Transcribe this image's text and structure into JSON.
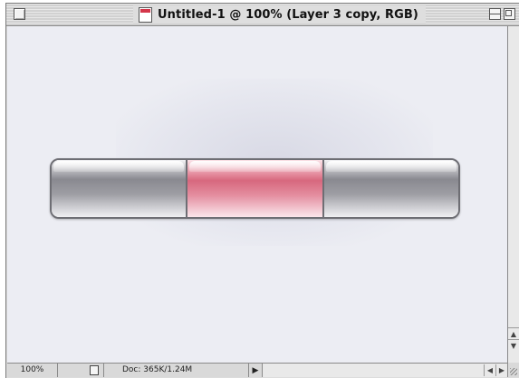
{
  "window": {
    "title": "Untitled-1 @ 100% (Layer 3 copy, RGB)"
  },
  "canvas": {
    "buttons": [
      {
        "name": "left-segment",
        "label": "",
        "state": "normal",
        "color": "#9e9ea4"
      },
      {
        "name": "middle-segment",
        "label": "",
        "state": "active",
        "color": "#d7687e"
      },
      {
        "name": "right-segment",
        "label": "",
        "state": "normal",
        "color": "#9e9ea4"
      }
    ]
  },
  "statusbar": {
    "zoom": "100%",
    "doc_info": "Doc: 365K/1.24M",
    "arrow": "▶"
  },
  "scroll": {
    "up_arrow": "▲",
    "down_arrow": "▼",
    "left_arrow": "◀",
    "right_arrow": "▶"
  },
  "colors": {
    "accent": "#d7687e",
    "chrome": "#dcdcdc"
  }
}
